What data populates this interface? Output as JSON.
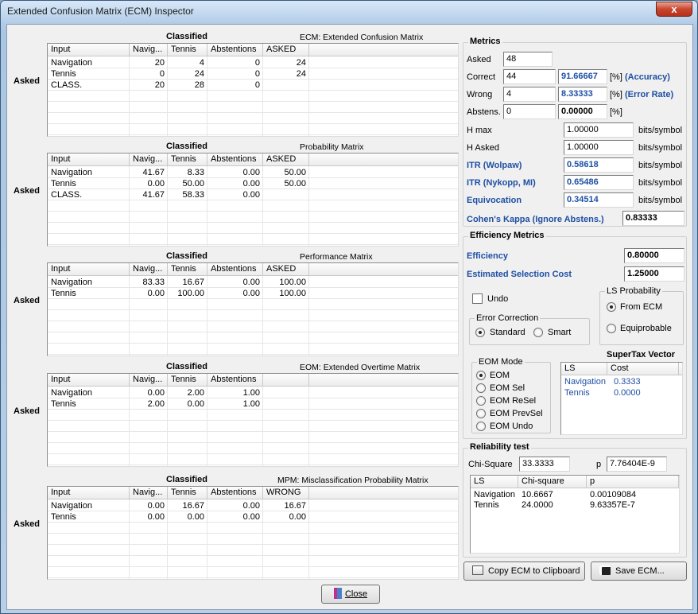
{
  "window": {
    "title": "Extended Confusion Matrix (ECM) Inspector",
    "close_glyph": "x"
  },
  "matrices": [
    {
      "asked_label": "Asked",
      "classified_label": "Classified",
      "title": "ECM: Extended Confusion Matrix",
      "columns": [
        "Input",
        "Navig...",
        "Tennis",
        "Abstentions",
        "ASKED"
      ],
      "rows": [
        [
          "Navigation",
          "20",
          "4",
          "0",
          "24"
        ],
        [
          "Tennis",
          "0",
          "24",
          "0",
          "24"
        ],
        [
          "CLASS.",
          "20",
          "28",
          "0",
          ""
        ]
      ]
    },
    {
      "asked_label": "Asked",
      "classified_label": "Classified",
      "title": "Probability Matrix",
      "columns": [
        "Input",
        "Navig...",
        "Tennis",
        "Abstentions",
        "ASKED"
      ],
      "rows": [
        [
          "Navigation",
          "41.67",
          "8.33",
          "0.00",
          "50.00"
        ],
        [
          "Tennis",
          "0.00",
          "50.00",
          "0.00",
          "50.00"
        ],
        [
          "CLASS.",
          "41.67",
          "58.33",
          "0.00",
          ""
        ]
      ]
    },
    {
      "asked_label": "Asked",
      "classified_label": "Classified",
      "title": "Performance Matrix",
      "columns": [
        "Input",
        "Navig...",
        "Tennis",
        "Abstentions",
        "ASKED"
      ],
      "rows": [
        [
          "Navigation",
          "83.33",
          "16.67",
          "0.00",
          "100.00"
        ],
        [
          "Tennis",
          "0.00",
          "100.00",
          "0.00",
          "100.00"
        ]
      ]
    },
    {
      "asked_label": "Asked",
      "classified_label": "Classified",
      "title": "EOM: Extended Overtime Matrix",
      "columns": [
        "Input",
        "Navig...",
        "Tennis",
        "Abstentions",
        ""
      ],
      "rows": [
        [
          "Navigation",
          "0.00",
          "2.00",
          "1.00",
          ""
        ],
        [
          "Tennis",
          "2.00",
          "0.00",
          "1.00",
          ""
        ]
      ]
    },
    {
      "asked_label": "Asked",
      "classified_label": "Classified",
      "title": "MPM: Misclassification Probability Matrix",
      "columns": [
        "Input",
        "Navig...",
        "Tennis",
        "Abstentions",
        "WRONG"
      ],
      "rows": [
        [
          "Navigation",
          "0.00",
          "16.67",
          "0.00",
          "16.67"
        ],
        [
          "Tennis",
          "0.00",
          "0.00",
          "0.00",
          "0.00"
        ]
      ]
    }
  ],
  "close_button": {
    "label": "Close"
  },
  "metrics": {
    "group_label": "Metrics",
    "asked": {
      "label": "Asked",
      "value": "48"
    },
    "correct": {
      "label": "Correct",
      "value": "44",
      "pct": "91.66667",
      "unit": "[%]",
      "desc": "(Accuracy)"
    },
    "wrong": {
      "label": "Wrong",
      "value": "4",
      "pct": "8.33333",
      "unit": "[%]",
      "desc": "(Error Rate)"
    },
    "abstens": {
      "label": "Abstens.",
      "value": "0",
      "pct": "0.00000",
      "unit": "[%]"
    },
    "hmax": {
      "label": "H max",
      "value": "1.00000",
      "unit": "bits/symbol"
    },
    "hasked": {
      "label": "H Asked",
      "value": "1.00000",
      "unit": "bits/symbol"
    },
    "itr_wolpaw": {
      "label": "ITR (Wolpaw)",
      "value": "0.58618",
      "unit": "bits/symbol"
    },
    "itr_nykopp": {
      "label": "ITR (Nykopp, MI)",
      "value": "0.65486",
      "unit": "bits/symbol"
    },
    "equivocation": {
      "label": "Equivocation",
      "value": "0.34514",
      "unit": "bits/symbol"
    },
    "kappa": {
      "label": "Cohen's Kappa (Ignore Abstens.)",
      "value": "0.83333"
    }
  },
  "efficiency": {
    "group_label": "Efficiency Metrics",
    "efficiency": {
      "label": "Efficiency",
      "value": "0.80000"
    },
    "selection_cost": {
      "label": "Estimated Selection Cost",
      "value": "1.25000"
    },
    "undo_label": "Undo",
    "error_correction": {
      "label": "Error Correction",
      "options": [
        "Standard",
        "Smart"
      ],
      "selected": "Standard"
    },
    "ls_probability": {
      "label": "LS Probability",
      "options": [
        "From ECM",
        "Equiprobable"
      ],
      "selected": "From ECM"
    },
    "eom_mode": {
      "label": "EOM Mode",
      "options": [
        "EOM",
        "EOM Sel",
        "EOM ReSel",
        "EOM PrevSel",
        "EOM Undo"
      ],
      "selected": "EOM"
    },
    "supertax": {
      "label": "SuperTax Vector",
      "columns": [
        "LS",
        "Cost"
      ],
      "rows": [
        [
          "Navigation",
          "0.3333"
        ],
        [
          "Tennis",
          "0.0000"
        ]
      ]
    }
  },
  "reliability": {
    "group_label": "Reliability test",
    "chi_label": "Chi-Square",
    "chi_value": "33.3333",
    "p_label": "p",
    "p_value": "7.76404E-9",
    "columns": [
      "LS",
      "Chi-square",
      "p"
    ],
    "rows": [
      [
        "Navigation",
        "10.6667",
        "0.00109084"
      ],
      [
        "Tennis",
        "24.0000",
        "9.63357E-7"
      ]
    ]
  },
  "buttons": {
    "copy": "Copy ECM to Clipboard",
    "save": "Save ECM..."
  }
}
